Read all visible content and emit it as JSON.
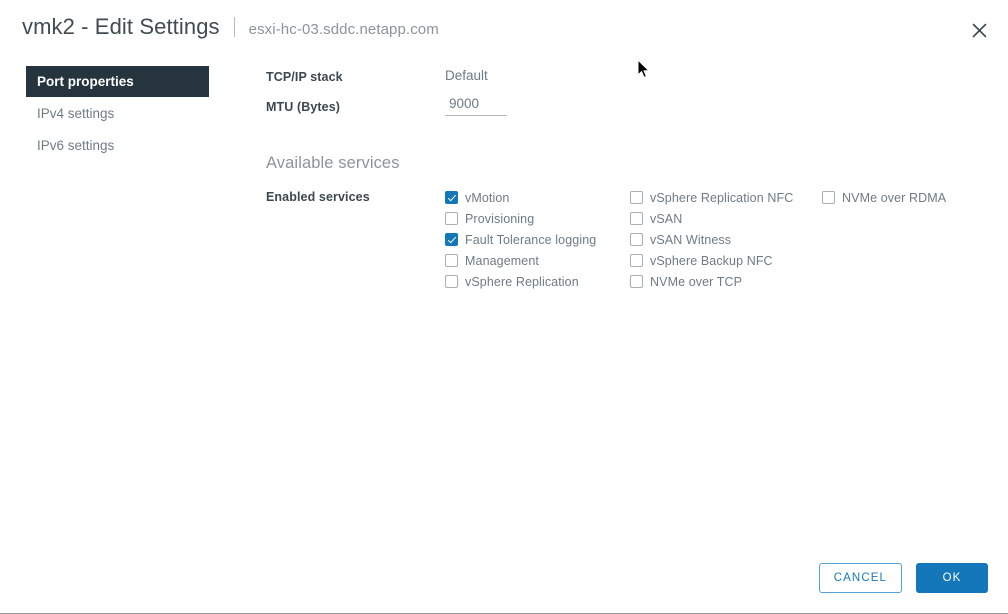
{
  "header": {
    "title": "vmk2 - Edit Settings",
    "subtitle": "esxi-hc-03.sddc.netapp.com",
    "close_icon": "close-icon"
  },
  "sidebar": {
    "items": [
      {
        "label": "Port properties",
        "active": true
      },
      {
        "label": "IPv4 settings",
        "active": false
      },
      {
        "label": "IPv6 settings",
        "active": false
      }
    ]
  },
  "main": {
    "fields": [
      {
        "label": "TCP/IP stack",
        "value": "Default",
        "type": "text"
      },
      {
        "label": "MTU (Bytes)",
        "value": "9000",
        "type": "input"
      }
    ],
    "section_heading": "Available services",
    "services_label": "Enabled services",
    "service_columns": [
      [
        {
          "label": "vMotion",
          "checked": true
        },
        {
          "label": "Provisioning",
          "checked": false
        },
        {
          "label": "Fault Tolerance logging",
          "checked": true
        },
        {
          "label": "Management",
          "checked": false
        },
        {
          "label": "vSphere Replication",
          "checked": false
        }
      ],
      [
        {
          "label": "vSphere Replication NFC",
          "checked": false
        },
        {
          "label": "vSAN",
          "checked": false
        },
        {
          "label": "vSAN Witness",
          "checked": false
        },
        {
          "label": "vSphere Backup NFC",
          "checked": false
        },
        {
          "label": "NVMe over TCP",
          "checked": false
        }
      ],
      [
        {
          "label": "NVMe over RDMA",
          "checked": false
        }
      ]
    ]
  },
  "footer": {
    "cancel_label": "CANCEL",
    "ok_label": "OK"
  },
  "colors": {
    "accent": "#1377ba",
    "sidebar_active_bg": "#26343e",
    "title_text": "#414b52",
    "muted_text": "#6e7b85"
  }
}
